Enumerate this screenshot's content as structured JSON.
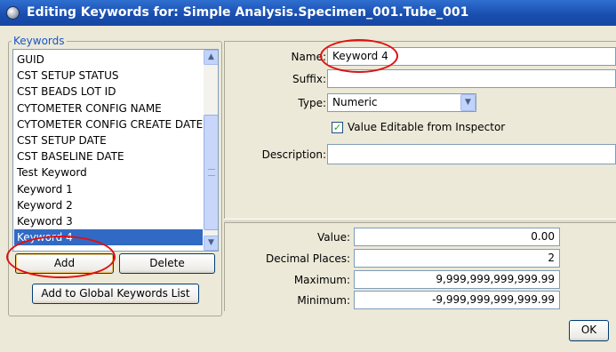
{
  "window": {
    "title": "Editing Keywords for: Simple Analysis.Specimen_001.Tube_001"
  },
  "keywords_group": {
    "label": "Keywords",
    "items": [
      {
        "label": "GUID"
      },
      {
        "label": "CST SETUP STATUS"
      },
      {
        "label": "CST BEADS LOT ID"
      },
      {
        "label": "CYTOMETER CONFIG NAME"
      },
      {
        "label": "CYTOMETER CONFIG CREATE DATE"
      },
      {
        "label": "CST SETUP DATE"
      },
      {
        "label": "CST BASELINE DATE"
      },
      {
        "label": "Test Keyword"
      },
      {
        "label": "Keyword 1"
      },
      {
        "label": "Keyword 2"
      },
      {
        "label": "Keyword 3"
      },
      {
        "label": "Keyword 4",
        "selected": true
      }
    ],
    "add_label": "Add",
    "delete_label": "Delete",
    "add_global_label": "Add to Global Keywords List"
  },
  "details": {
    "name_label": "Name:",
    "name_value": "Keyword 4",
    "suffix_label": "Suffix:",
    "suffix_value": "",
    "type_label": "Type:",
    "type_value": "Numeric",
    "editable_label": "Value Editable from Inspector",
    "editable_checked": true,
    "description_label": "Description:",
    "description_value": ""
  },
  "values": {
    "value_label": "Value:",
    "value": "0.00",
    "decimal_label": "Decimal Places:",
    "decimal": "2",
    "maximum_label": "Maximum:",
    "maximum": "9,999,999,999,999.99",
    "minimum_label": "Minimum:",
    "minimum": "-9,999,999,999,999.99"
  },
  "footer": {
    "ok_label": "OK"
  },
  "icons": {
    "window_icon": "window-icon",
    "scroll_up": "chevron-up-icon",
    "scroll_down": "chevron-down-icon",
    "dropdown": "chevron-down-icon",
    "check": "checkmark-icon"
  },
  "colors": {
    "titlebar": "#1a4fb0",
    "selection": "#316ac5",
    "annotation": "#e01010",
    "group_label": "#1a55c8"
  }
}
